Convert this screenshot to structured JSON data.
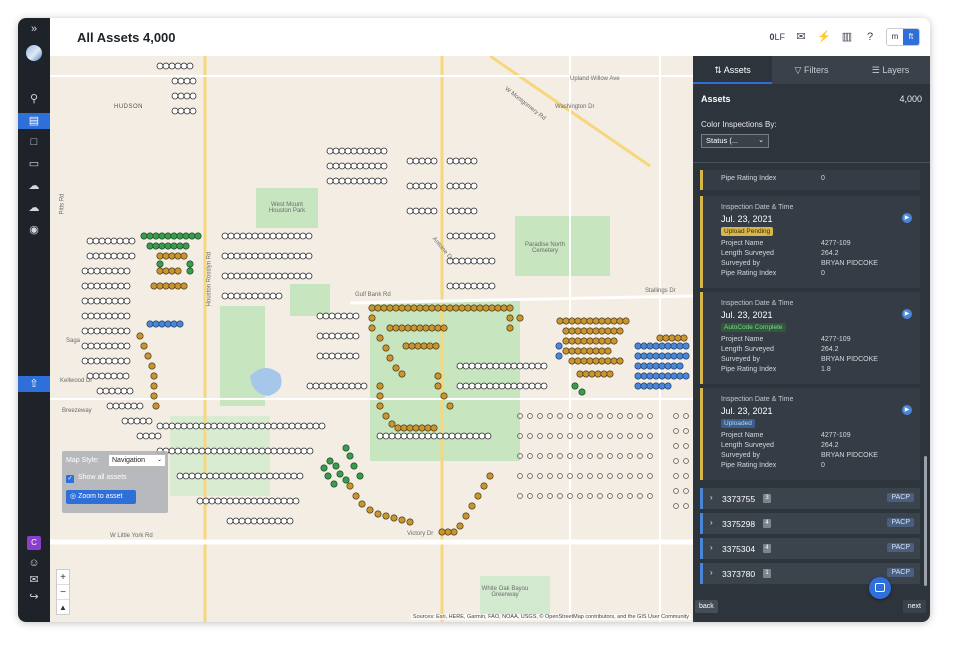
{
  "app": {
    "page_title": "All Assets 4,000"
  },
  "header": {
    "lf_value": "0",
    "lf_unit": "LF",
    "units": [
      "m",
      "ft"
    ],
    "active_unit": "ft"
  },
  "rail": {
    "icons": [
      "expand-icon",
      "logo",
      "search-icon",
      "map-icon",
      "chat-icon",
      "inbox-icon",
      "cloud-upload-icon",
      "cloud-download-icon",
      "ai-icon",
      "upload-icon",
      "avatar",
      "user-icon",
      "mail-icon",
      "logout-icon"
    ],
    "avatar_initial": "C"
  },
  "map": {
    "labels": {
      "hudson": "HUDSON",
      "upland_willow": "Upland Willow Ave",
      "washington": "Washington Dr",
      "w_montgomery": "W Montgomery Rd",
      "west_mount_houston_park": "West Mount Houston Park",
      "paradise_north_cemetery": "Paradise North Cemetery",
      "gulf_bank": "Gulf Bank Rd",
      "stallings": "Stallings Dr",
      "kellwood": "Kellwood Dr",
      "breezeway": "Breezeway",
      "w_little_york": "W Little York Rd",
      "victory": "Victory Dr",
      "white_oak_bayou": "White Oak Bayou Greenway",
      "antoine": "Antoine Dr",
      "houston_rosslyn": "Houston Rosslyn Rd",
      "sagebrush": "Saga",
      "pitts": "Pitts Rd"
    },
    "map_style_label": "Map Style:",
    "map_style_value": "Navigation",
    "show_all_assets": "Show all assets",
    "zoom_to_asset": "Zoom to asset",
    "zoom_in": "+",
    "zoom_out": "−",
    "attribution": "Sources: Esri, HERE, Garmin, FAO, NOAA, USGS, © OpenStreetMap contributors, and the GIS User Community",
    "colors": {
      "uploaded": "#4a86d8",
      "pending": "#c8952f",
      "complete": "#3a9a4e",
      "default": "#ffffff"
    }
  },
  "panel": {
    "tabs": [
      "Assets",
      "Filters",
      "Layers"
    ],
    "active_tab": "Assets",
    "assets_label": "Assets",
    "assets_count": "4,000",
    "color_by_label": "Color Inspections By:",
    "color_by_value": "Status (...",
    "partial_row": {
      "label": "Pipe Rating Index",
      "value": "0"
    },
    "inspections": [
      {
        "header": "Inspection Date & Time",
        "date": "Jul. 23, 2021",
        "status": "Upload Pending",
        "project_name": "4277-109",
        "length_surveyed": "264.2",
        "surveyed_by": "BRYAN PIDCOKE",
        "pipe_rating_index": "0"
      },
      {
        "header": "Inspection Date & Time",
        "date": "Jul. 23, 2021",
        "status": "AutoCode Complete",
        "project_name": "4277-109",
        "length_surveyed": "264.2",
        "surveyed_by": "BRYAN PIDCOKE",
        "pipe_rating_index": "1.8"
      },
      {
        "header": "Inspection Date & Time",
        "date": "Jul. 23, 2021",
        "status": "Uploaded",
        "project_name": "4277-109",
        "length_surveyed": "264.2",
        "surveyed_by": "BRYAN PIDCOKE",
        "pipe_rating_index": "0"
      }
    ],
    "field_labels": {
      "project_name": "Project Name",
      "length_surveyed": "Length Surveyed",
      "surveyed_by": "Surveyed by",
      "pipe_rating_index": "Pipe Rating Index"
    },
    "assets": [
      {
        "id": "3373755",
        "count": "3",
        "tag": "PACP"
      },
      {
        "id": "3375298",
        "count": "4",
        "tag": "PACP"
      },
      {
        "id": "3375304",
        "count": "4",
        "tag": "PACP"
      },
      {
        "id": "3373780",
        "count": "1",
        "tag": "PACP"
      }
    ],
    "back_label": "back",
    "next_label": "next"
  }
}
